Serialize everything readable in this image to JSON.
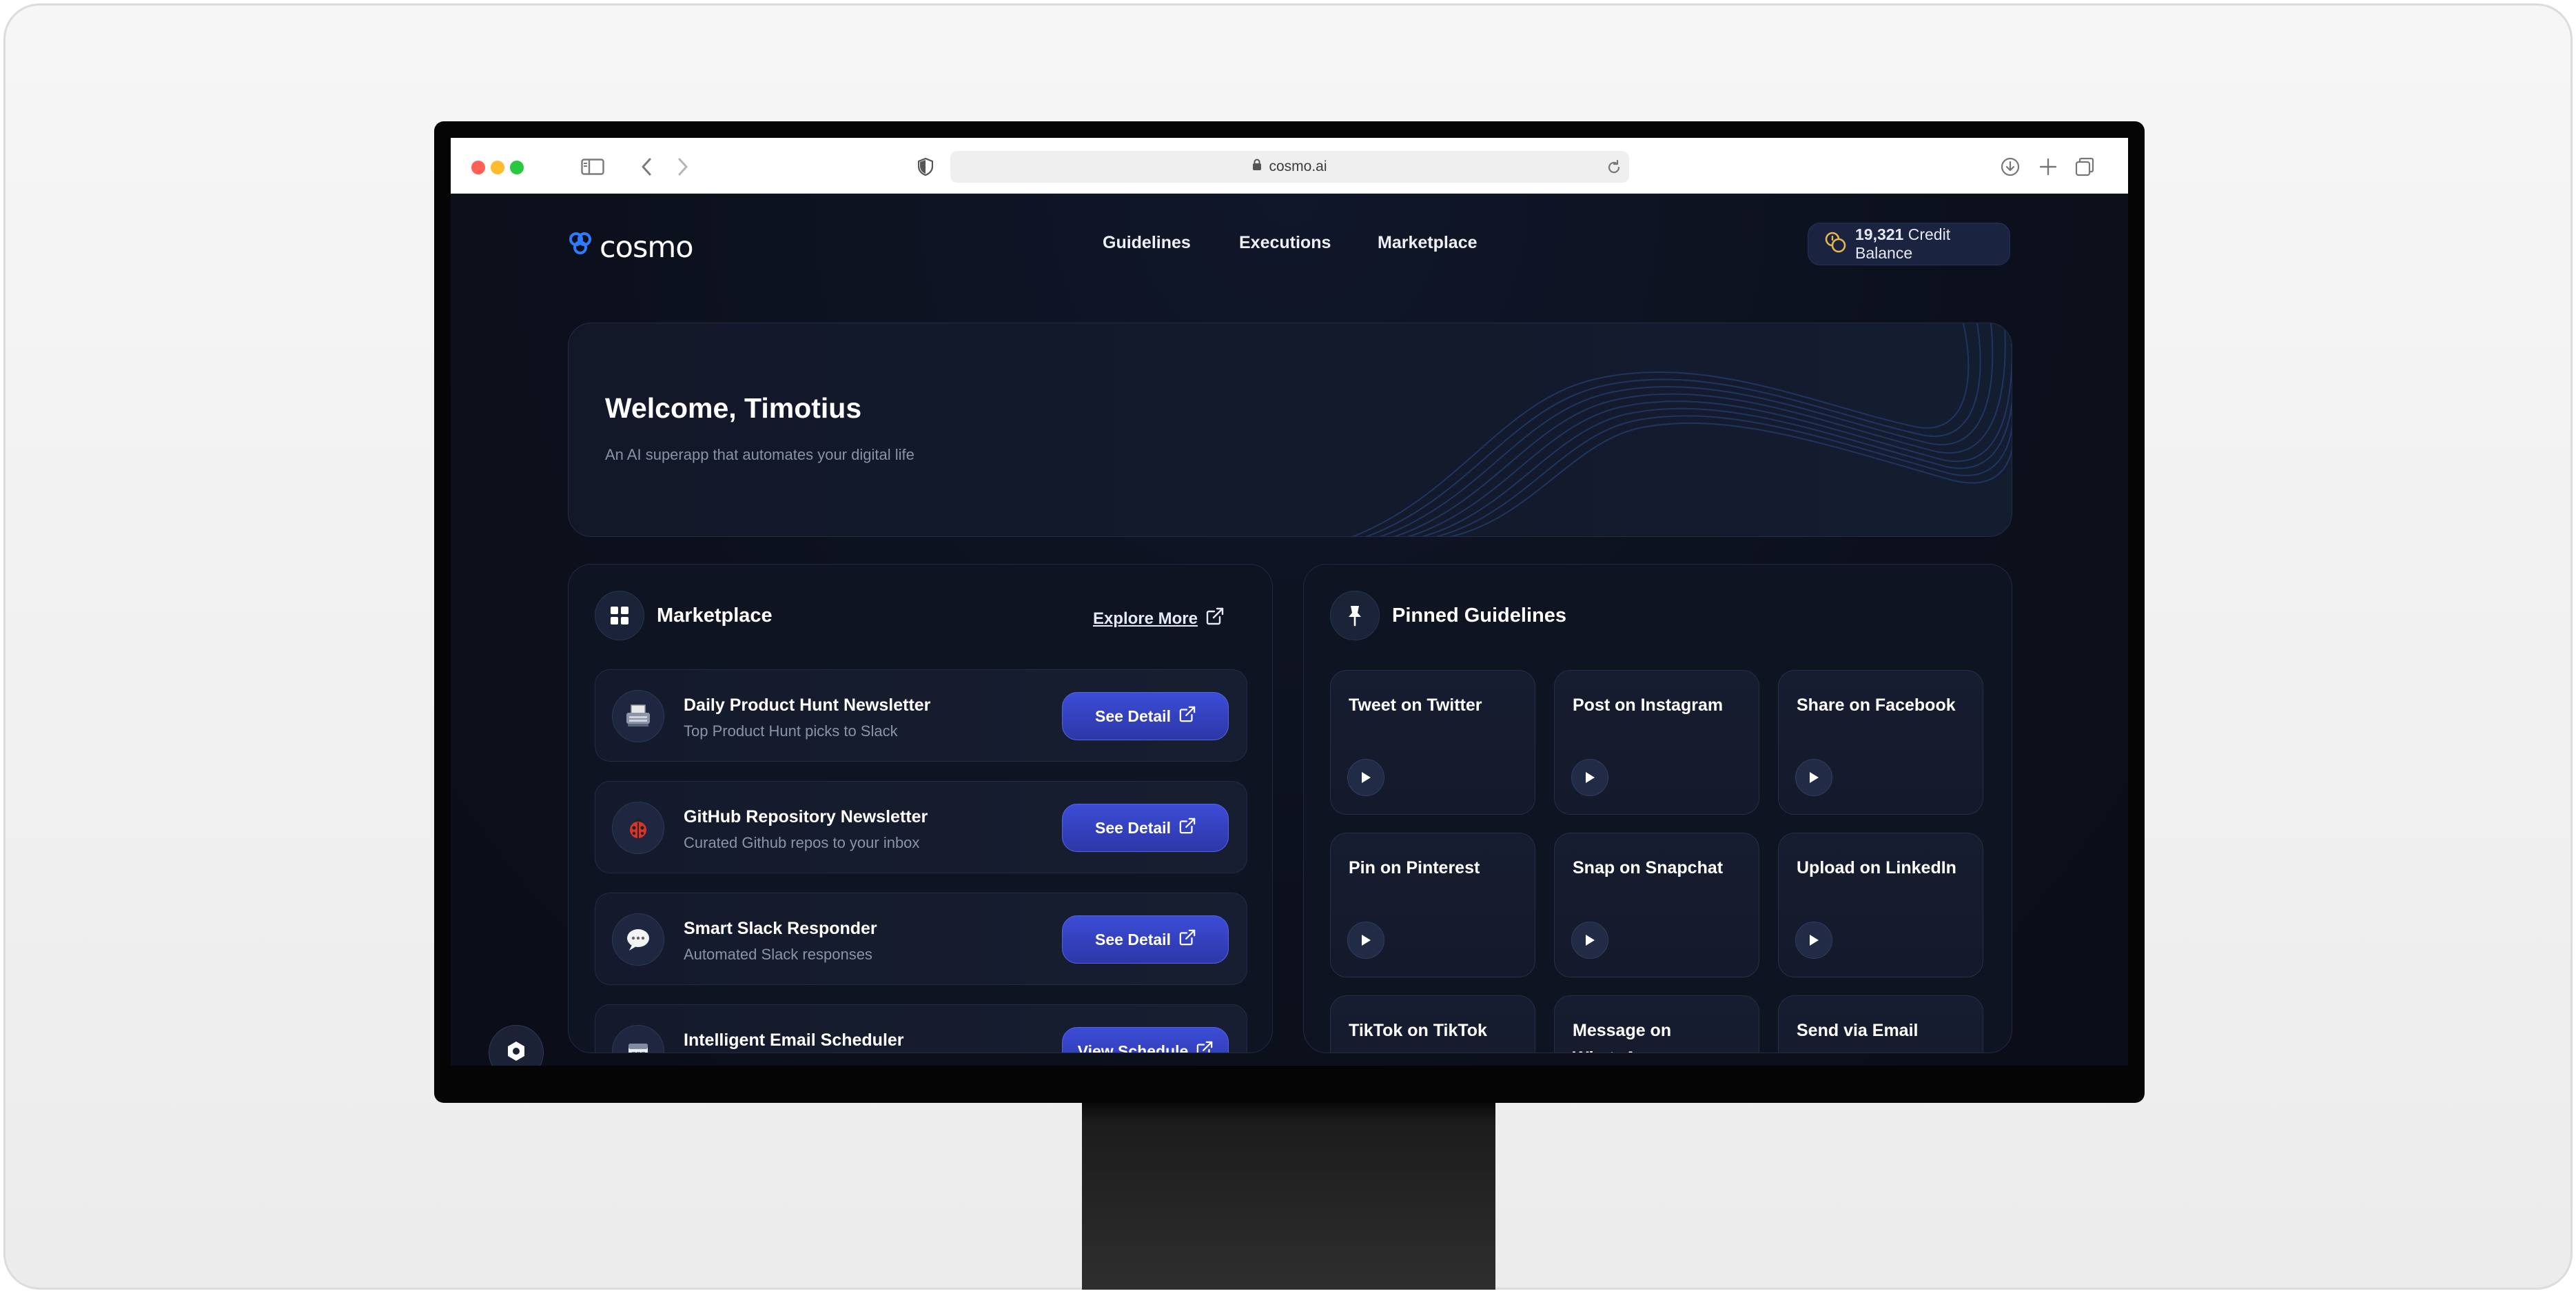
{
  "browser": {
    "url": "cosmo.ai"
  },
  "app": {
    "logo_text": "cosmo",
    "nav": [
      "Guidelines",
      "Executions",
      "Marketplace"
    ],
    "credits": {
      "amount": "19,321",
      "label": "Credit Balance"
    },
    "hero": {
      "title": "Welcome, Timotius",
      "subtitle": "An AI superapp that automates your digital life"
    },
    "marketplace": {
      "title": "Marketplace",
      "explore_label": "Explore More",
      "items": [
        {
          "name": "Daily Product Hunt Newsletter",
          "desc": "Top Product Hunt picks to Slack",
          "button": "See Detail",
          "icon": "typewriter-icon"
        },
        {
          "name": "GitHub Repository Newsletter",
          "desc": "Curated Github repos to your inbox",
          "button": "See Detail",
          "icon": "ladybug-icon"
        },
        {
          "name": "Smart Slack Responder",
          "desc": "Automated Slack responses",
          "button": "See Detail",
          "icon": "speech-bubble-icon"
        },
        {
          "name": "Intelligent Email Scheduler",
          "desc": "",
          "button": "View Schedule",
          "icon": "calendar-icon"
        }
      ]
    },
    "pinned": {
      "title": "Pinned Guidelines",
      "items": [
        "Tweet on Twitter",
        "Post on Instagram",
        "Share on Facebook",
        "Pin on Pinterest",
        "Snap on Snapchat",
        "Upload on LinkedIn",
        "TikTok on TikTok",
        "Message on WhatsApp",
        "Send via Email"
      ]
    },
    "colors": {
      "background": "#0d111d",
      "accent": "#3c4cd6",
      "logo_blue": "#2f7bff"
    }
  }
}
